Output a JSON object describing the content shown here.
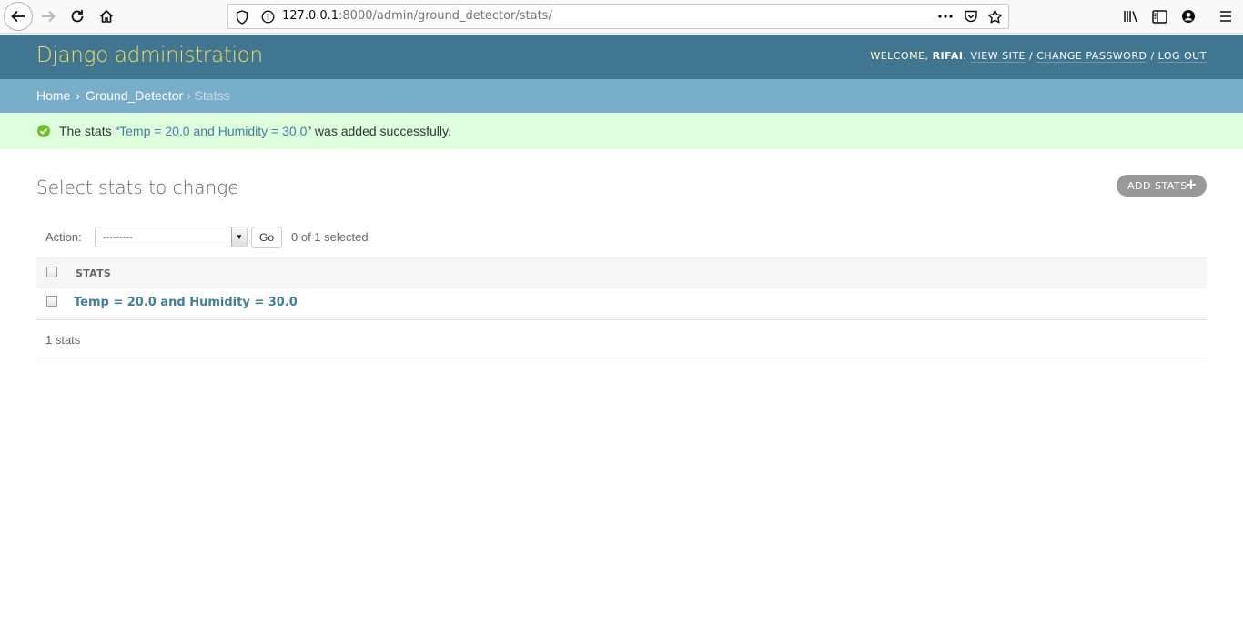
{
  "browser": {
    "url_host": "127.0.0.1",
    "url_rest": ":8000/admin/ground_detector/stats/"
  },
  "header": {
    "branding": "Django administration",
    "welcome": "Welcome, ",
    "username": "rifai",
    "view_site": "View site",
    "change_password": "Change password",
    "log_out": "Log out"
  },
  "breadcrumbs": {
    "home": "Home",
    "app": "Ground_Detector",
    "current": "Statss"
  },
  "message": {
    "prefix": "The stats “",
    "object": "Temp = 20.0 and Humidity = 30.0",
    "suffix": "” was added successfully."
  },
  "content": {
    "title": "Select stats to change",
    "add_button": "Add stats",
    "action_label": "Action:",
    "action_selected": "---------",
    "go_button": "Go",
    "counter": "0 of 1 selected",
    "column_header": "Stats",
    "rows": [
      "Temp = 20.0 and Humidity = 30.0"
    ],
    "paginator": "1 stats"
  },
  "colors": {
    "header_bg": "#417690",
    "breadcrumb_bg": "#79aec8",
    "branding": "#f5dd5d",
    "success_bg": "#ddffdd",
    "link": "#447e9b"
  }
}
